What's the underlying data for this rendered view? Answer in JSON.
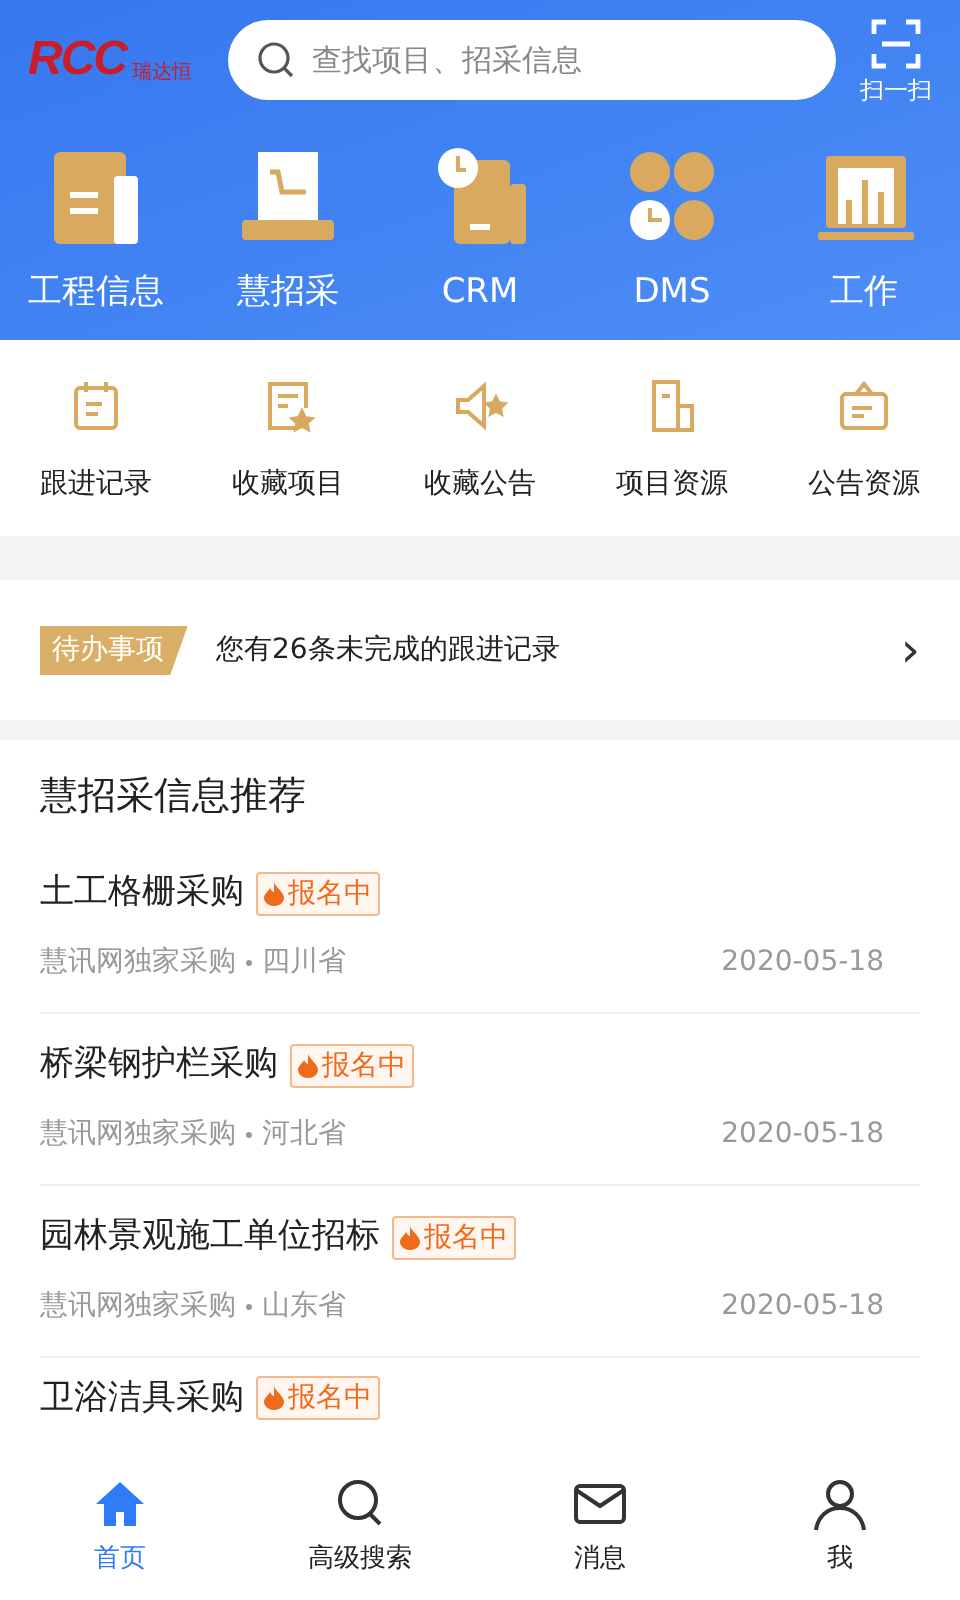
{
  "header": {
    "logo": {
      "mark": "RCC",
      "name": "瑞达恒"
    },
    "search": {
      "placeholder": "查找项目、招采信息"
    },
    "scan": "扫一扫"
  },
  "main_nav": [
    {
      "kind": "doc",
      "label": "工程信息"
    },
    {
      "kind": "cart",
      "label": "慧招采"
    },
    {
      "kind": "clock",
      "label": "CRM"
    },
    {
      "kind": "hex",
      "label": "DMS"
    },
    {
      "kind": "chart",
      "label": "工作"
    }
  ],
  "shortcuts": [
    {
      "kind": "calendar",
      "label": "跟进记录"
    },
    {
      "kind": "star-doc",
      "label": "收藏项目"
    },
    {
      "kind": "speaker",
      "label": "收藏公告"
    },
    {
      "kind": "building",
      "label": "项目资源"
    },
    {
      "kind": "bag",
      "label": "公告资源"
    }
  ],
  "todo": {
    "tag": "待办事项",
    "text": "您有26条未完成的跟进记录",
    "chevron": "›"
  },
  "recommend": {
    "title": "慧招采信息推荐",
    "items": [
      {
        "title": "土工格栅采购",
        "badge": "报名中",
        "source": "慧讯网独家采购",
        "region": "四川省",
        "date": "2020-05-18"
      },
      {
        "title": "桥梁钢护栏采购",
        "badge": "报名中",
        "source": "慧讯网独家采购",
        "region": "河北省",
        "date": "2020-05-18"
      },
      {
        "title": "园林景观施工单位招标",
        "badge": "报名中",
        "source": "慧讯网独家采购",
        "region": "山东省",
        "date": "2020-05-18"
      },
      {
        "title": "卫浴洁具采购",
        "badge": "报名中"
      }
    ]
  },
  "tab_bar": [
    {
      "kind": "home",
      "label": "首页",
      "selected": true
    },
    {
      "kind": "search",
      "label": "高级搜索",
      "selected": false
    },
    {
      "kind": "mail",
      "label": "消息",
      "selected": false
    },
    {
      "kind": "user",
      "label": "我",
      "selected": false
    }
  ]
}
